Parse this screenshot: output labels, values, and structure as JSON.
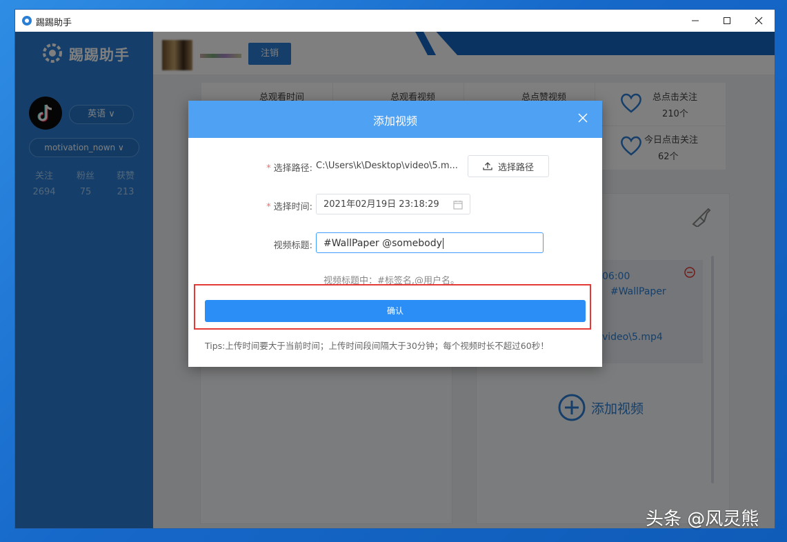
{
  "window": {
    "title": "踢踢助手"
  },
  "header": {
    "logo_text": "踢踢助手",
    "logout_label": "注销"
  },
  "sidebar": {
    "language": "英语 ∨",
    "account": "motivation_nown ∨",
    "stats": [
      {
        "label": "关注",
        "value": "2694"
      },
      {
        "label": "粉丝",
        "value": "75"
      },
      {
        "label": "获赞",
        "value": "213"
      }
    ]
  },
  "stats_panel": {
    "items": [
      {
        "label": "总观看时间",
        "value": ""
      },
      {
        "label": "总观看视频",
        "value": ""
      },
      {
        "label": "总点赞视频",
        "value": ""
      },
      {
        "label": "总点击关注",
        "value": "210个"
      },
      {
        "label": "今日点击关注",
        "value": "62个"
      }
    ]
  },
  "video_card": {
    "time": "06:00",
    "tag": "#WallPaper",
    "path": "video\\5.mp4"
  },
  "add_video_label": "添加视频",
  "modal": {
    "title": "添加视频",
    "path_label": "选择路径",
    "path_value": "C:\\Users\\k\\Desktop\\video\\5.m...",
    "path_button": "选择路径",
    "time_label": "选择时间",
    "time_value": "2021年02月19日 23:18:29",
    "video_title_label": "视频标题",
    "video_title_value": "#WallPaper @somebody",
    "hint": "视频标题中：#标签名,@用户名。",
    "confirm_label": "确认",
    "tips": "Tips:上传时间要大于当前时间；上传时间段间隔大于30分钟；每个视频时长不超过60秒！"
  },
  "watermark": "头条 @风灵熊",
  "colors": {
    "accent": "#2a7fd4",
    "modal_header": "#4ea1f3",
    "confirm": "#2a8ef6",
    "highlight_box": "#e53935"
  }
}
